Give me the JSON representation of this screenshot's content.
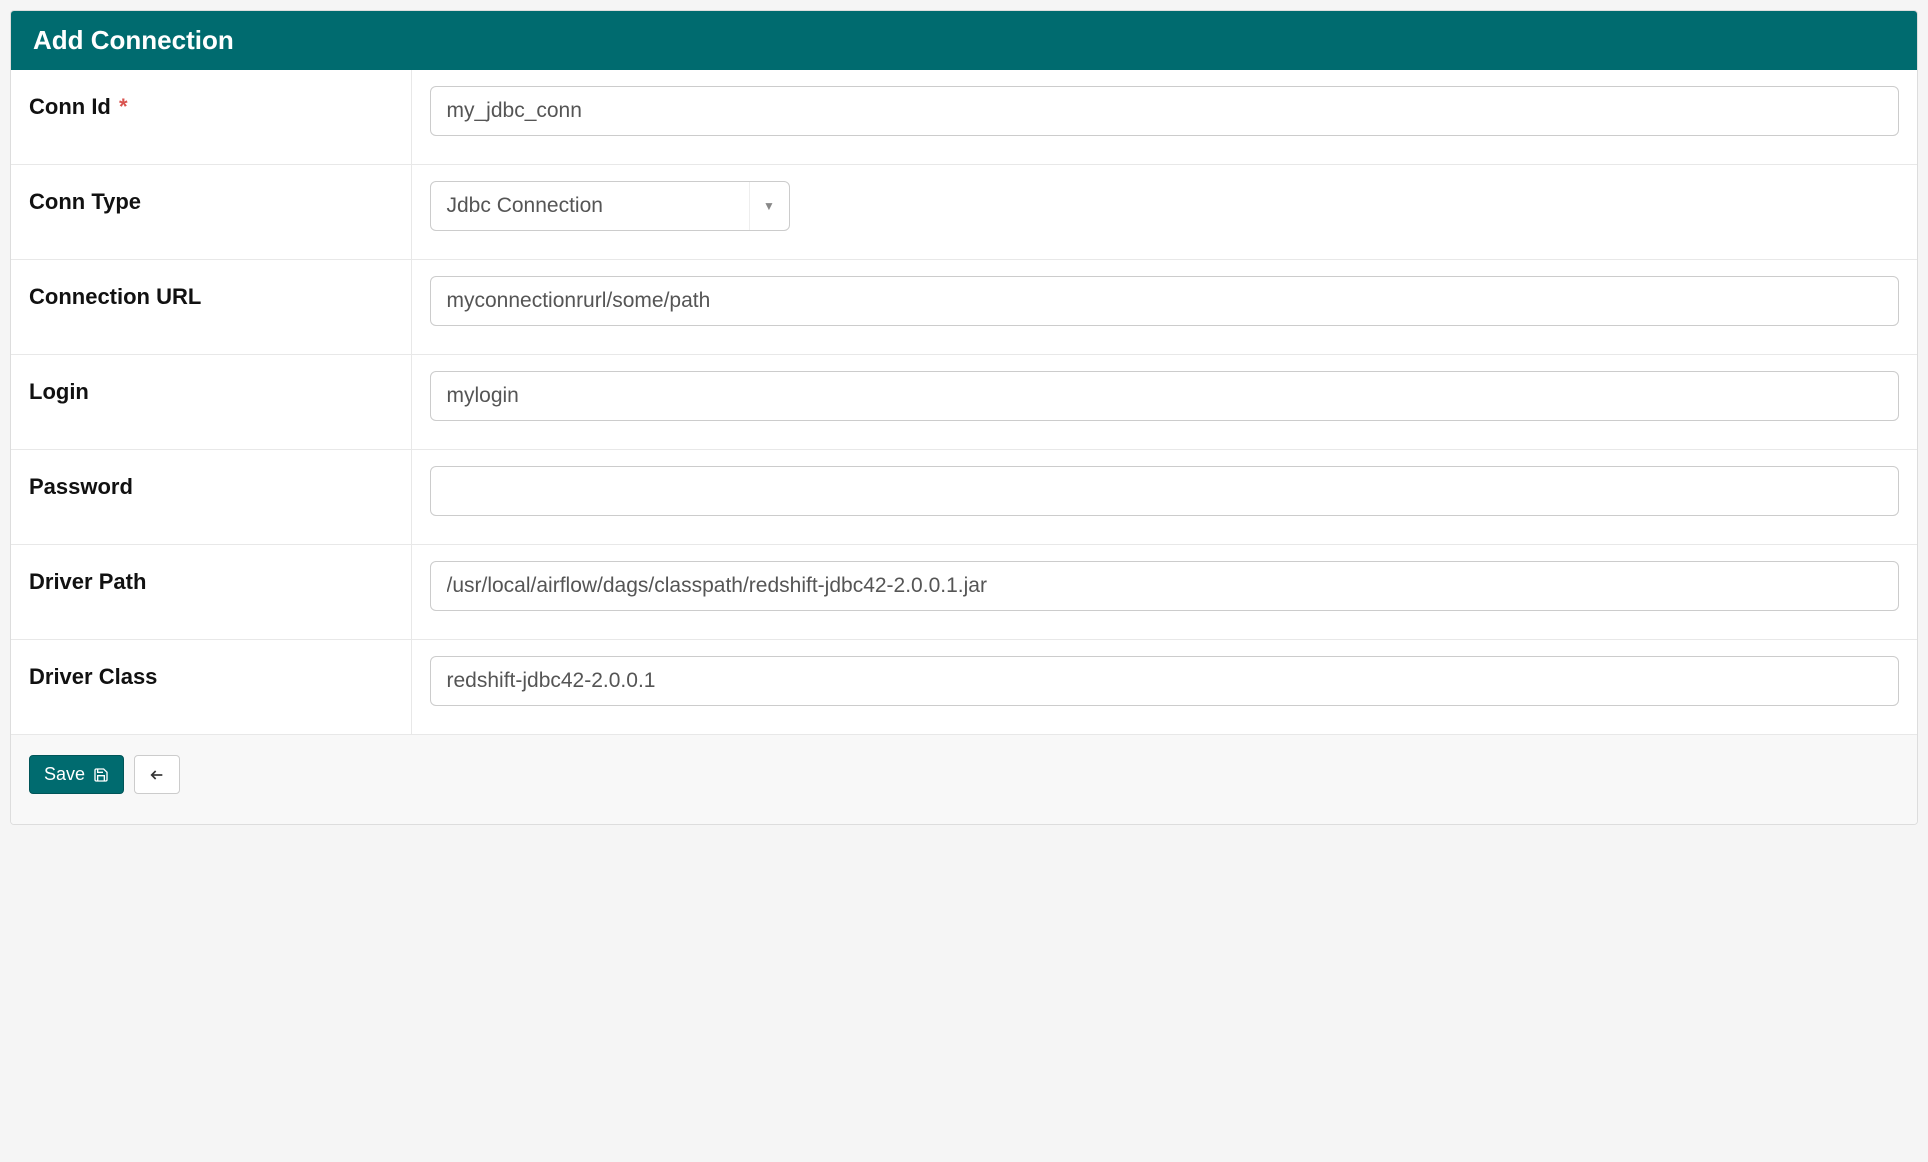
{
  "header": {
    "title": "Add Connection"
  },
  "form": {
    "conn_id": {
      "label": "Conn Id",
      "required_marker": "*",
      "value": "my_jdbc_conn"
    },
    "conn_type": {
      "label": "Conn Type",
      "value": "Jdbc Connection"
    },
    "connection_url": {
      "label": "Connection URL",
      "value": "myconnectionrurl/some/path"
    },
    "login": {
      "label": "Login",
      "value": "mylogin"
    },
    "password": {
      "label": "Password",
      "value": ""
    },
    "driver_path": {
      "label": "Driver Path",
      "value": "/usr/local/airflow/dags/classpath/redshift-jdbc42-2.0.0.1.jar"
    },
    "driver_class": {
      "label": "Driver Class",
      "value": "redshift-jdbc42-2.0.0.1"
    }
  },
  "footer": {
    "save_label": "Save"
  }
}
